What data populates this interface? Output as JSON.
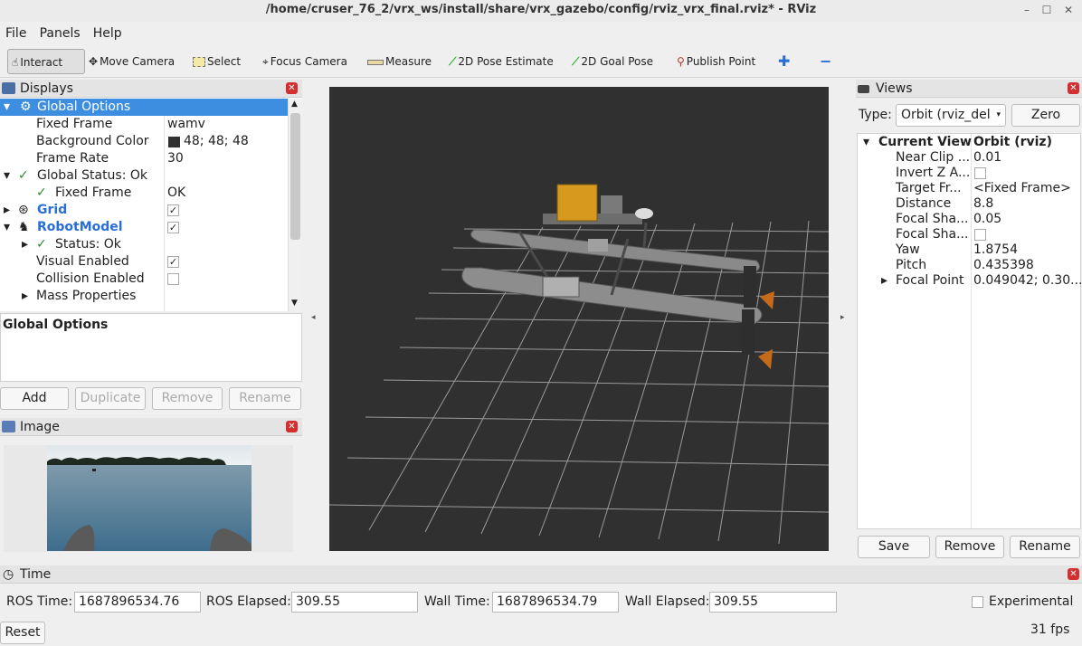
{
  "window": {
    "title": "/home/cruser_76_2/vrx_ws/install/share/vrx_gazebo/config/rviz_vrx_final.rviz* - RViz"
  },
  "menu": [
    "File",
    "Panels",
    "Help"
  ],
  "toolbar": {
    "interact": "Interact",
    "move_camera": "Move Camera",
    "select": "Select",
    "focus_camera": "Focus Camera",
    "measure": "Measure",
    "pose_estimate": "2D Pose Estimate",
    "goal_pose": "2D Goal Pose",
    "publish_point": "Publish Point"
  },
  "displays": {
    "title": "Displays",
    "tree": {
      "global_options": "Global Options",
      "fixed_frame_label": "Fixed Frame",
      "fixed_frame_value": "wamv",
      "bg_color_label": "Background Color",
      "bg_color_value": "48; 48; 48",
      "frame_rate_label": "Frame Rate",
      "frame_rate_value": "30",
      "global_status": "Global Status: Ok",
      "status_fixed_frame": "Fixed Frame",
      "status_fixed_frame_value": "OK",
      "grid": "Grid",
      "robot_model": "RobotModel",
      "status_ok": "Status: Ok",
      "visual_enabled": "Visual Enabled",
      "collision_enabled": "Collision Enabled",
      "mass_properties": "Mass Properties"
    },
    "description_title": "Global Options",
    "buttons": {
      "add": "Add",
      "duplicate": "Duplicate",
      "remove": "Remove",
      "rename": "Rename"
    }
  },
  "image_panel": {
    "title": "Image"
  },
  "views": {
    "title": "Views",
    "type_label": "Type:",
    "type_value": "Orbit (rviz_del",
    "zero": "Zero",
    "props": [
      {
        "name": "Current View",
        "value": "Orbit (rviz)"
      },
      {
        "name": "Near Clip ...",
        "value": "0.01"
      },
      {
        "name": "Invert Z A...",
        "value": ""
      },
      {
        "name": "Target Fr...",
        "value": "<Fixed Frame>"
      },
      {
        "name": "Distance",
        "value": "8.8"
      },
      {
        "name": "Focal Sha...",
        "value": "0.05"
      },
      {
        "name": "Focal Sha...",
        "value": ""
      },
      {
        "name": "Yaw",
        "value": "1.8754"
      },
      {
        "name": "Pitch",
        "value": "0.435398"
      },
      {
        "name": "Focal Point",
        "value": "0.049042; 0.30..."
      }
    ],
    "buttons": {
      "save": "Save",
      "remove": "Remove",
      "rename": "Rename"
    }
  },
  "time": {
    "title": "Time",
    "ros_time_label": "ROS Time:",
    "ros_time": "1687896534.76",
    "ros_elapsed_label": "ROS Elapsed:",
    "ros_elapsed": "309.55",
    "wall_time_label": "Wall Time:",
    "wall_time": "1687896534.79",
    "wall_elapsed_label": "Wall Elapsed:",
    "wall_elapsed": "309.55",
    "experimental": "Experimental",
    "reset": "Reset",
    "fps": "31 fps"
  },
  "colors": {
    "selection": "#3d8ee0",
    "viewport_bg": "#303030",
    "link_blue": "#2a6fd6"
  }
}
